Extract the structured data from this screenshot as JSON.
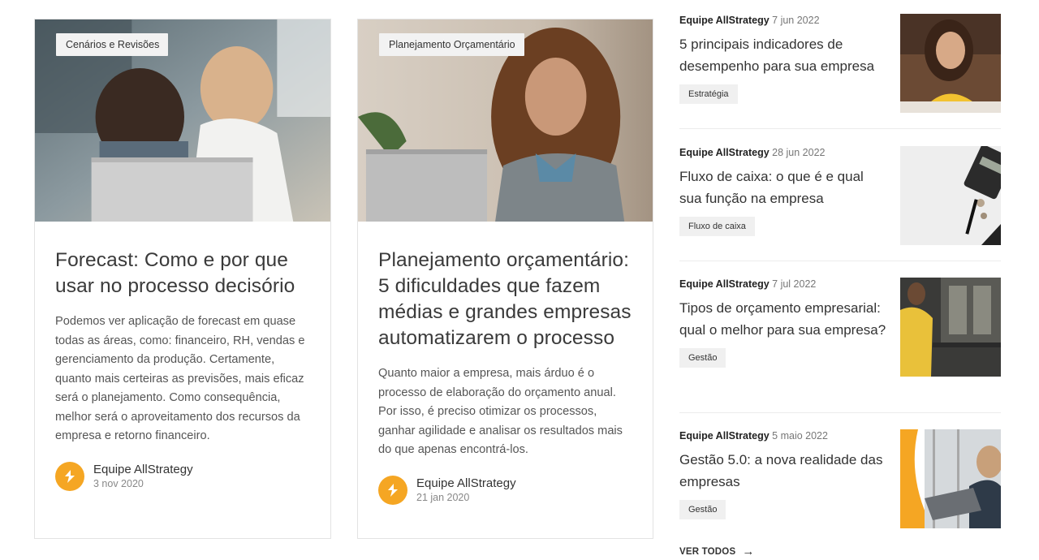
{
  "cards": [
    {
      "tag": "Cenários e Revisões",
      "title": "Forecast: Como e por que usar no processo decisório",
      "excerpt": "Podemos ver aplicação de forecast em quase todas as áreas, como: financeiro, RH, vendas e gerenciamento da produção. Certamente, quanto mais certeiras as previsões, mais eficaz será o planejamento. Como consequência, melhor será o aproveitamento dos recursos da empresa e retorno financeiro.",
      "author": "Equipe AllStrategy",
      "date": "3 nov 2020"
    },
    {
      "tag": "Planejamento Orçamentário",
      "title": "Planejamento orçamentário: 5 dificuldades que fazem médias e grandes empresas automatizarem o processo",
      "excerpt": "Quanto maior a empresa, mais árduo é o processo de elaboração do orçamento anual. Por isso, é preciso otimizar os processos, ganhar agilidade e analisar os resultados mais do que apenas encontrá-los.",
      "author": "Equipe AllStrategy",
      "date": "21 jan 2020"
    }
  ],
  "side_posts": [
    {
      "author": "Equipe AllStrategy",
      "date": "7 jun 2022",
      "title": "5 principais indicadores de desempenho para sua empresa",
      "tag": "Estratégia"
    },
    {
      "author": "Equipe AllStrategy",
      "date": "28 jun 2022",
      "title": "Fluxo de caixa: o que é e qual sua função na empresa",
      "tag": "Fluxo de caixa"
    },
    {
      "author": "Equipe AllStrategy",
      "date": "7 jul 2022",
      "title": "Tipos de orçamento empresarial: qual o melhor para sua empresa?",
      "tag": "Gestão"
    },
    {
      "author": "Equipe AllStrategy",
      "date": "5 maio 2022",
      "title": "Gestão 5.0: a nova realidade das empresas",
      "tag": "Gestão"
    }
  ],
  "view_all": "VER TODOS",
  "colors": {
    "accent": "#f5a623"
  }
}
